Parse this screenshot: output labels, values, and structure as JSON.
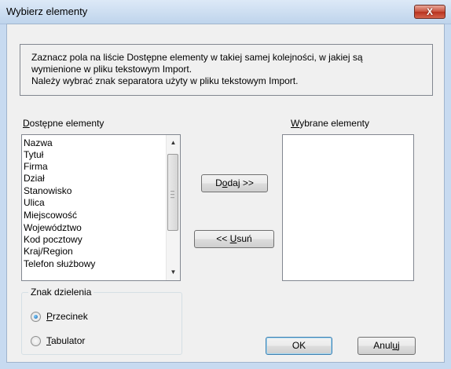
{
  "window": {
    "title": "Wybierz elementy",
    "close_glyph": "X"
  },
  "instructions": {
    "line1": "Zaznacz pola na liście Dostępne elementy w takiej samej kolejności, w jakiej są",
    "line2": "wymienione w pliku tekstowym Import.",
    "line3": "Należy wybrać znak separatora użyty w pliku tekstowym Import."
  },
  "available": {
    "label_mnemonic": "D",
    "label_rest": "ostępne elementy",
    "items": [
      "Nazwa",
      "Tytuł",
      "Firma",
      "Dział",
      "Stanowisko",
      "Ulica",
      "Miejscowość",
      "Województwo",
      "Kod pocztowy",
      "Kraj/Region",
      "Telefon służbowy"
    ]
  },
  "selected": {
    "label_mnemonic": "W",
    "label_rest": "ybrane elementy"
  },
  "buttons": {
    "add_pre": "D",
    "add_mnemonic": "o",
    "add_post": "daj >>",
    "remove_pre": "<< ",
    "remove_mnemonic": "U",
    "remove_post": "suń",
    "ok": "OK",
    "cancel_pre": "Anul",
    "cancel_mnemonic": "u",
    "cancel_post": "j"
  },
  "separator": {
    "legend": "Znak dzielenia",
    "selected": "Przecinek",
    "options": [
      {
        "mnemonic": "P",
        "rest": "rzecinek"
      },
      {
        "mnemonic": "T",
        "rest": "abulator"
      }
    ]
  },
  "icons": {
    "scroll_up": "scroll-up-arrow-icon",
    "scroll_down": "scroll-down-arrow-icon",
    "close": "close-icon",
    "radio_selected": "radio-selected-icon"
  },
  "colors": {
    "title_bar": "#c7daf0",
    "close_button": "#c8503c",
    "dialog_bg": "#f0f0f0",
    "default_button_border": "#3c7fb1"
  }
}
